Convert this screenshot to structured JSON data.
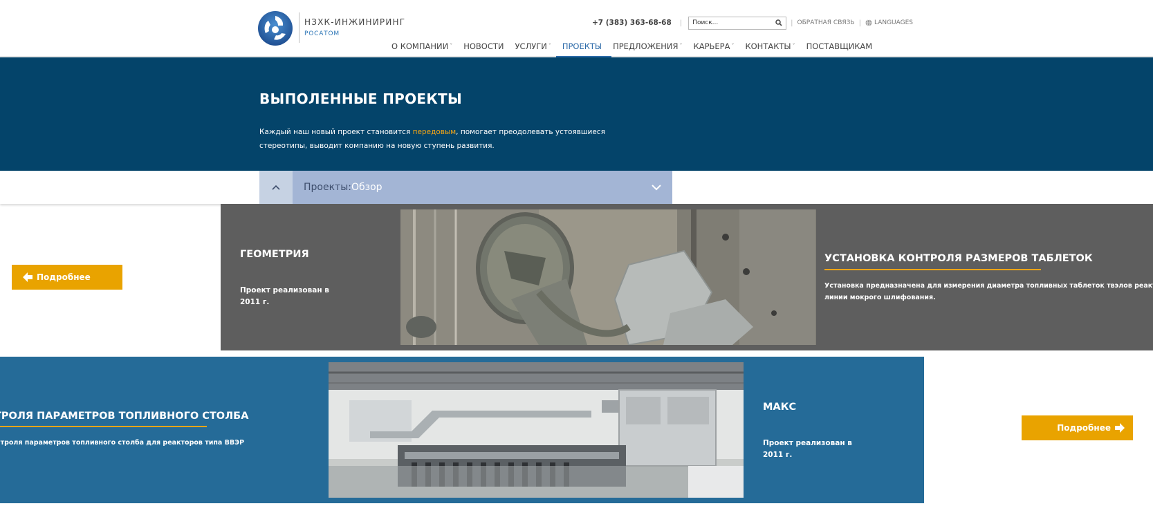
{
  "header": {
    "brand_name": "НЗХК-ИНЖИНИРИНГ",
    "brand_sub": "РОСАТОМ",
    "phone": "+7 (383) 363-68-68",
    "search_placeholder": "Поиск...",
    "feedback": "ОБРАТНАЯ СВЯЗЬ",
    "languages": "LANGUAGES",
    "nav": [
      {
        "label": "О КОМПАНИИ",
        "dropdown": true
      },
      {
        "label": "НОВОСТИ",
        "dropdown": false
      },
      {
        "label": "УСЛУГИ",
        "dropdown": true
      },
      {
        "label": "ПРОЕКТЫ",
        "dropdown": false,
        "active": true
      },
      {
        "label": "ПРЕДЛОЖЕНИЯ",
        "dropdown": true
      },
      {
        "label": "КАРЬЕРА",
        "dropdown": true
      },
      {
        "label": "КОНТАКТЫ",
        "dropdown": true
      },
      {
        "label": "ПОСТАВЩИКАМ",
        "dropdown": false
      }
    ],
    "chevron": "˅"
  },
  "hero": {
    "title": "ВЫПОЛЕННЫЕ ПРОЕКТЫ",
    "desc_before": "Каждый наш новый проект становится ",
    "desc_highlight": "передовым",
    "desc_after": ", помогает преодолевать устоявшиеся стереотипы, выводит компанию на новую ступень развития."
  },
  "breadcrumb": {
    "section": "Проекты: ",
    "current": "Обзор"
  },
  "projects": [
    {
      "title": "ГЕОМЕТРИЯ",
      "year": "Проект реализован в 2011 г.",
      "caption_title": "УСТАНОВКА КОНТРОЛЯ РАЗМЕРОВ ТАБЛЕТОК",
      "caption_desc_1": "Установка предназначена для измерения диаметра топливных таблеток твэлов реакторов типа В",
      "caption_desc_2": "линии мокрого шлифования.",
      "button": "Подробнее"
    },
    {
      "title": "МАКС",
      "year": "Проект реализован в 2011 г.",
      "caption_title": "ТРОЛЯ ПАРАМЕТРОВ ТОПЛИВНОГО СТОЛБА",
      "caption_desc_1": "нтроля параметров топливного столба для реакторов типа ВВЭР",
      "button": "Подробнее"
    }
  ],
  "colors": {
    "hero_bg": "#04446a",
    "accent": "#f2a516",
    "button": "#e9a300",
    "row1_bg": "#5e5e5e",
    "row2_bg": "#256b98",
    "breadcrumb_bg": "#a3b5d5"
  }
}
